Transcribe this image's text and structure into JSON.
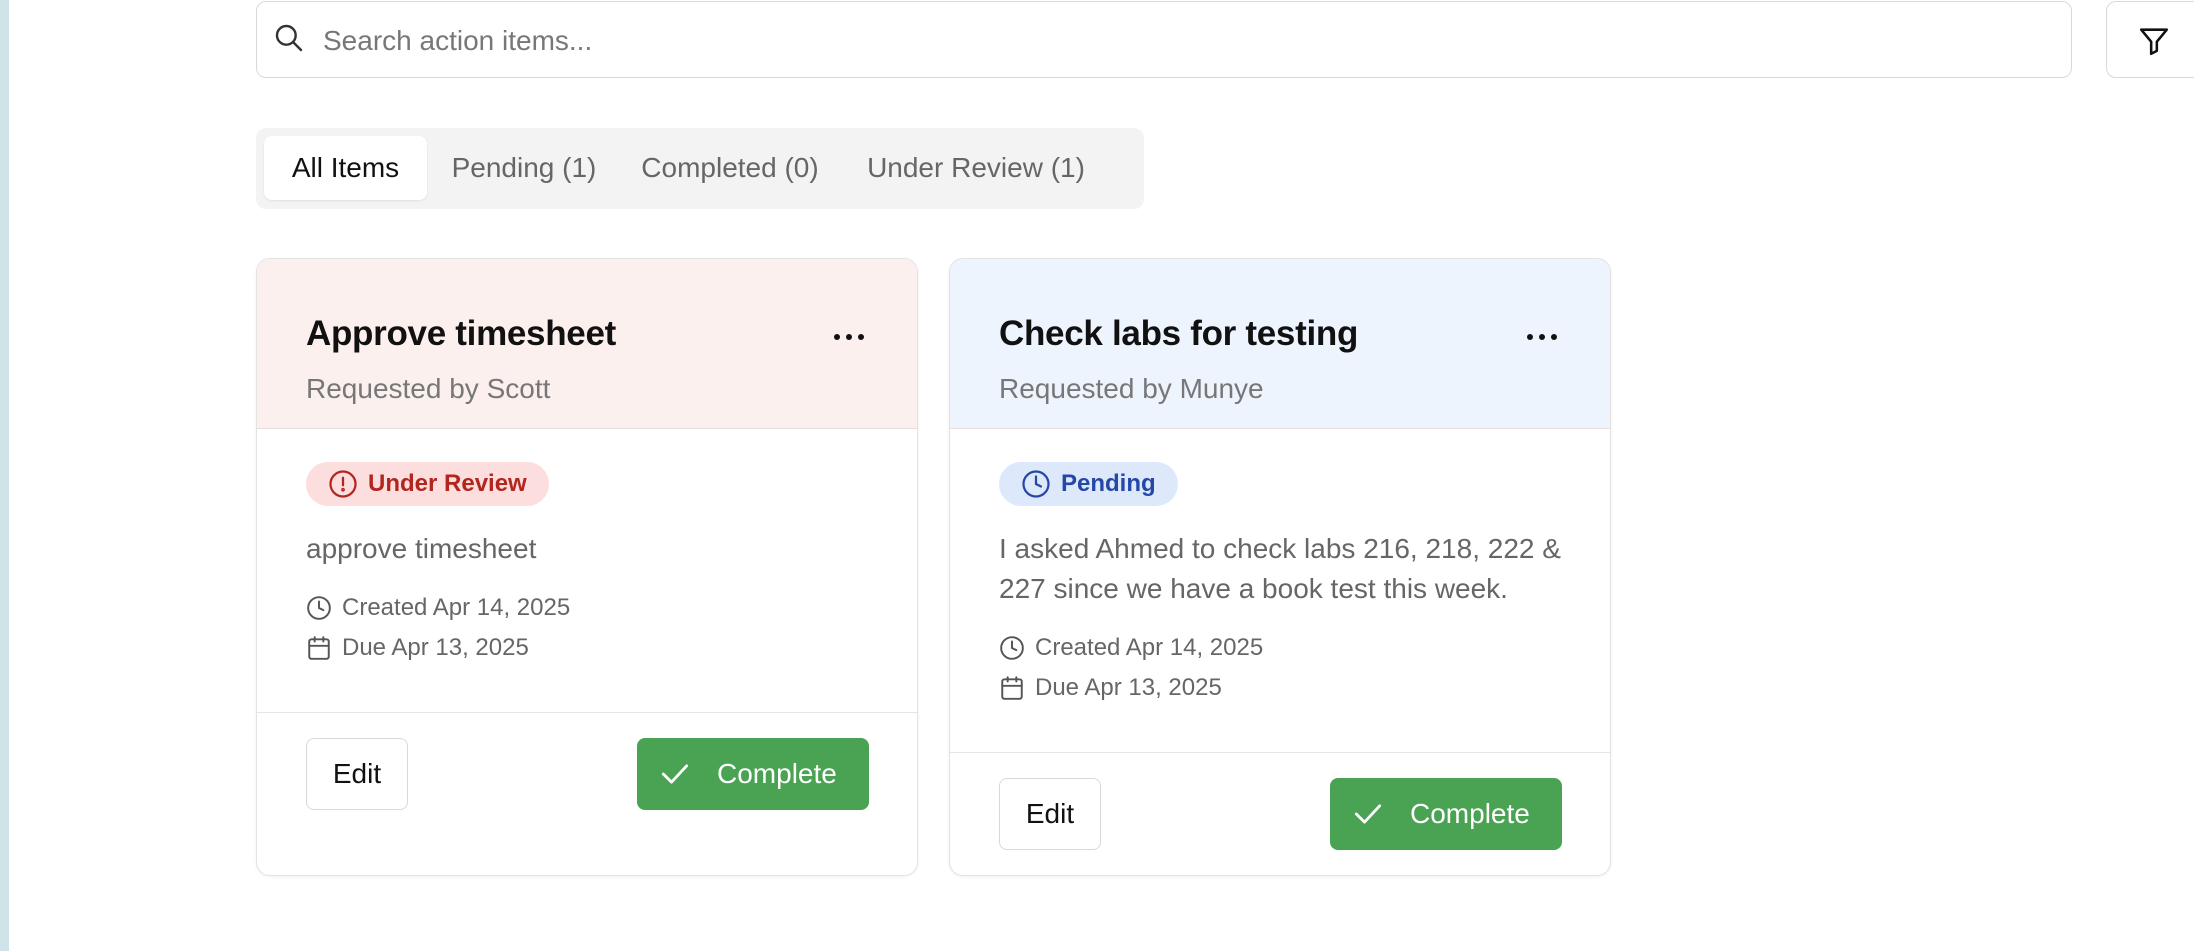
{
  "search": {
    "placeholder": "Search action items..."
  },
  "icons": {
    "search": "search-icon",
    "filter": "filter-icon",
    "more": "more-horizontal-icon",
    "clock": "clock-icon",
    "calendar": "calendar-icon",
    "check": "check-icon",
    "alert": "alert-circle-icon"
  },
  "tabs": [
    {
      "label": "All Items",
      "active": true
    },
    {
      "label": "Pending (1)"
    },
    {
      "label": "Completed (0)"
    },
    {
      "label": "Under Review (1)"
    }
  ],
  "cards": [
    {
      "title": "Approve timesheet",
      "requested_by": "Requested by Scott",
      "status": "Under Review",
      "status_color": "#b3261e",
      "status_bg": "#fbdedd",
      "header_bg": "#fcf0ef",
      "description": "approve timesheet",
      "created": "Created Apr 14, 2025",
      "due": "Due Apr 13, 2025",
      "edit_label": "Edit",
      "complete_label": "Complete"
    },
    {
      "title": "Check labs for testing",
      "requested_by": "Requested by Munye",
      "status": "Pending",
      "status_color": "#2447a8",
      "status_bg": "#dde9fb",
      "header_bg": "#edf4fe",
      "description": "I asked Ahmed to check labs 216, 218, 222 & 227 since we have a book test this week.",
      "created": "Created Apr 14, 2025",
      "due": "Due Apr 13, 2025",
      "edit_label": "Edit",
      "complete_label": "Complete"
    }
  ],
  "colors": {
    "complete_button": "#4aa353",
    "tab_bar": "#f3f3f3"
  }
}
